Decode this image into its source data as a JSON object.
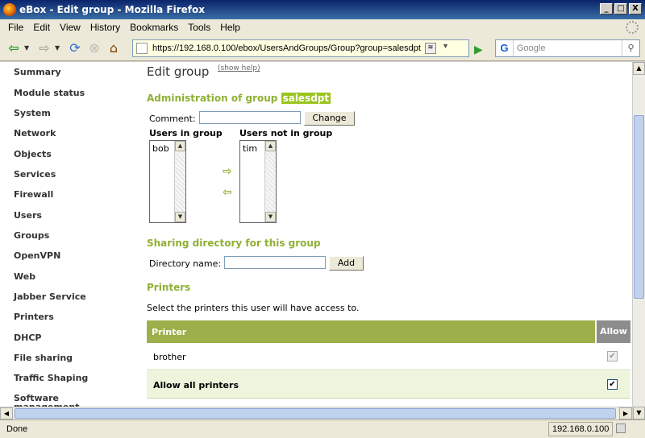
{
  "window": {
    "title": "eBox - Edit group - Mozilla Firefox",
    "minimize": "_",
    "maximize": "□",
    "close": "X"
  },
  "menu": [
    "File",
    "Edit",
    "View",
    "History",
    "Bookmarks",
    "Tools",
    "Help"
  ],
  "toolbar": {
    "url": "https://192.168.0.100/ebox/UsersAndGroups/Group?group=salesdpt",
    "search_placeholder": "Google",
    "search_engine": "G"
  },
  "sidebar": [
    "Summary",
    "Module status",
    "System",
    "Network",
    "Objects",
    "Services",
    "Firewall",
    "Users",
    "Groups",
    "OpenVPN",
    "Web",
    "Jabber Service",
    "Printers",
    "DHCP",
    "File sharing",
    "Traffic Shaping",
    "Software management"
  ],
  "main": {
    "title": "Edit group",
    "show_help": "(show help)",
    "admin_heading": "Administration of group",
    "group_name": "salesdpt",
    "comment_label": "Comment:",
    "comment_value": "",
    "change_button": "Change",
    "users_in_group_label": "Users in group",
    "users_not_in_group_label": "Users not in group",
    "users_in_group": [
      "bob"
    ],
    "users_not_in_group": [
      "tim"
    ],
    "sharing_heading": "Sharing directory for this group",
    "directory_label": "Directory name:",
    "directory_value": "",
    "add_button": "Add",
    "printers_heading": "Printers",
    "printers_desc": "Select the printers this user will have access to.",
    "table": {
      "headers": [
        "Printer",
        "Allow"
      ],
      "rows": [
        {
          "printer": "brother",
          "allow": true,
          "disabled": true
        },
        {
          "printer": "Allow all printers",
          "allow": true,
          "disabled": false
        }
      ]
    }
  },
  "status": {
    "text": "Done",
    "host": "192.168.0.100"
  },
  "colors": {
    "accent_green": "#8fb034",
    "table_header": "#9bb04a",
    "badge": "#9bc41e"
  }
}
